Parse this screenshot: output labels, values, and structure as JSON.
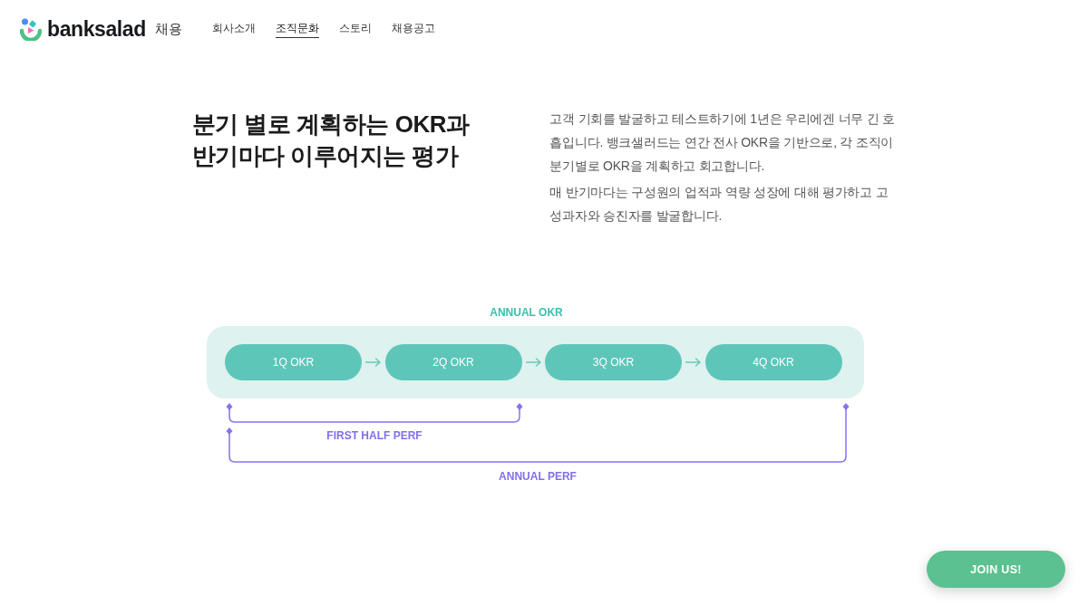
{
  "header": {
    "logo": {
      "wordmark": "banksalad",
      "suffix": "채용"
    },
    "nav": [
      {
        "label": "회사소개",
        "selected": false
      },
      {
        "label": "조직문화",
        "selected": true
      },
      {
        "label": "스토리",
        "selected": false
      },
      {
        "label": "채용공고",
        "selected": false
      }
    ]
  },
  "intro": {
    "title_lines": [
      "분기 별로 계획하는 OKR과",
      "반기마다 이루어지는 평가"
    ],
    "paragraphs": [
      "고객 기회를 발굴하고 테스트하기에 1년은 우리에겐 너무 긴 호흡입니다. 뱅크샐러드는 연간 전사 OKR을 기반으로, 각 조직이 분기별로 OKR을 계획하고 회고합니다.",
      "매 반기마다는 구성원의 업적과 역량 성장에 대해 평가하고 고성과자와 승진자를 발굴합니다."
    ]
  },
  "diagram": {
    "heading": "ANNUAL OKR",
    "quarters": [
      {
        "label": "1Q OKR"
      },
      {
        "label": "2Q OKR"
      },
      {
        "label": "3Q OKR"
      },
      {
        "label": "4Q OKR"
      }
    ],
    "brackets": [
      {
        "kind": "half",
        "label": "FIRST HALF PERF"
      },
      {
        "kind": "annual",
        "label": "ANNUAL PERF"
      }
    ]
  },
  "join_button": {
    "label": "JOIN US!"
  }
}
